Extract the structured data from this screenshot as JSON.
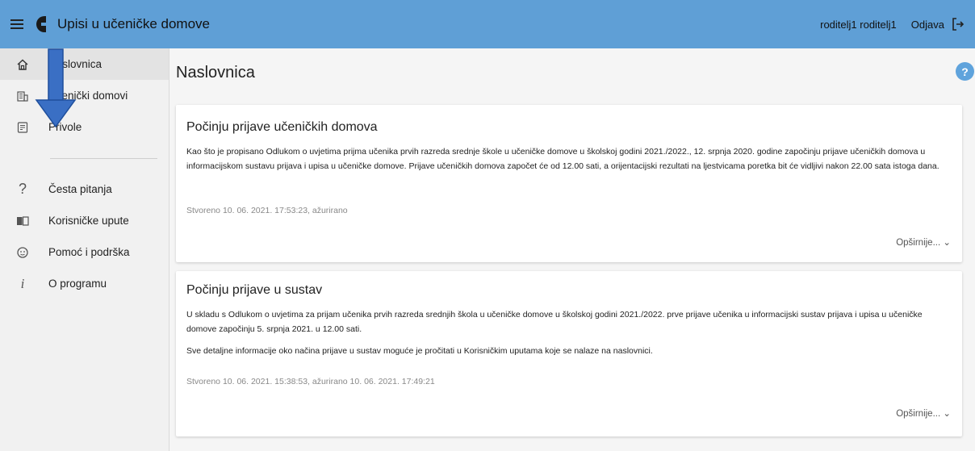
{
  "header": {
    "app_title": "Upisi u učeničke domove",
    "user_name": "roditelj1 roditelj1",
    "logout_label": "Odjava"
  },
  "sidebar": {
    "items": [
      {
        "label": "Naslovnica",
        "icon": "home-icon"
      },
      {
        "label": "Učenički domovi",
        "icon": "building-icon"
      },
      {
        "label": "Privole",
        "icon": "consent-icon"
      },
      {
        "label": "Česta pitanja",
        "icon": "question-icon"
      },
      {
        "label": "Korisničke upute",
        "icon": "book-icon"
      },
      {
        "label": "Pomoć i podrška",
        "icon": "support-icon"
      },
      {
        "label": "O programu",
        "icon": "info-icon"
      }
    ]
  },
  "main": {
    "page_title": "Naslovnica",
    "help_label": "?",
    "cards": [
      {
        "title": "Počinju prijave učeničkih domova",
        "paragraphs": [
          "Kao što je propisano Odlukom o uvjetima prijma učenika prvih razreda srednje škole u učeničke domove u školskoj godini 2021./2022., 12. srpnja 2020. godine započinju prijave učeničkih domova u informacijskom sustavu prijava i upisa u učeničke domove. Prijave učeničkih domova započet će od 12.00 sati, a orijentacijski rezultati na ljestvicama poretka bit će vidljivi nakon 22.00 sata istoga dana."
        ],
        "meta": "Stvoreno 10. 06. 2021. 17:53:23, ažurirano",
        "more": "Opširnije... ⌄"
      },
      {
        "title": "Počinju prijave u sustav",
        "paragraphs": [
          "U skladu s Odlukom o uvjetima za prijam učenika prvih razreda srednjih škola u učeničke domove u školskoj godini 2021./2022. prve prijave učenika u informacijski sustav prijava i upisa u učeničke domove započinju 5. srpnja 2021. u 12.00 sati.",
          "Sve detaljne informacije oko načina prijave u sustav moguće je pročitati u Korisničkim uputama koje se nalaze na naslovnici."
        ],
        "meta": "Stvoreno 10. 06. 2021. 15:38:53, ažurirano 10. 06. 2021. 17:49:21",
        "more": "Opširnije... ⌄"
      }
    ]
  },
  "colors": {
    "topbar": "#5f9fd6",
    "help_button": "#5fa3dc",
    "annotation_arrow": "#3a6fc4"
  }
}
